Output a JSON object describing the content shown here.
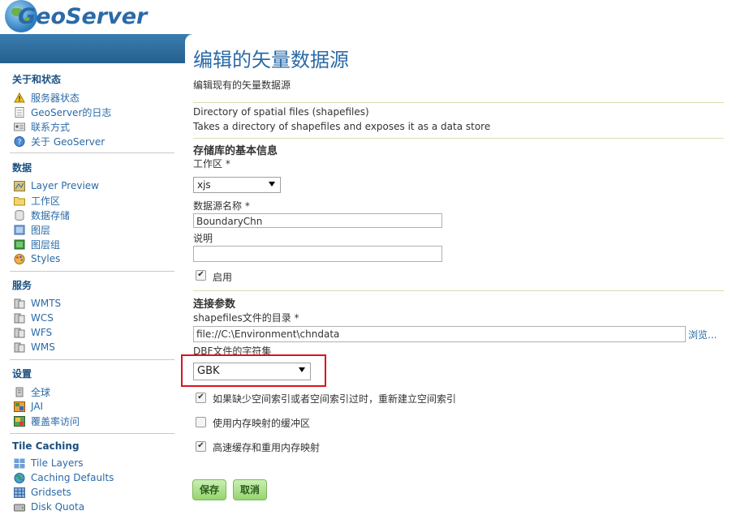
{
  "header": {
    "logo_text": "GeoServer"
  },
  "sidebar": {
    "sections": [
      {
        "title": "关于和状态",
        "items": [
          {
            "label": "服务器状态",
            "icon": "warning-icon"
          },
          {
            "label": "GeoServer的日志",
            "icon": "document-icon"
          },
          {
            "label": "联系方式",
            "icon": "contact-card-icon"
          },
          {
            "label": "关于 GeoServer",
            "icon": "help-icon"
          }
        ]
      },
      {
        "title": "数据",
        "items": [
          {
            "label": "Layer Preview",
            "icon": "map-preview-icon"
          },
          {
            "label": "工作区",
            "icon": "folder-icon"
          },
          {
            "label": "数据存储",
            "icon": "database-icon"
          },
          {
            "label": "图层",
            "icon": "layer-icon"
          },
          {
            "label": "图层组",
            "icon": "layer-group-icon"
          },
          {
            "label": "Styles",
            "icon": "palette-icon"
          }
        ]
      },
      {
        "title": "服务",
        "items": [
          {
            "label": "WMTS",
            "icon": "server-icon"
          },
          {
            "label": "WCS",
            "icon": "server-icon"
          },
          {
            "label": "WFS",
            "icon": "server-icon"
          },
          {
            "label": "WMS",
            "icon": "server-icon"
          }
        ]
      },
      {
        "title": "设置",
        "items": [
          {
            "label": "全球",
            "icon": "server-icon"
          },
          {
            "label": "JAI",
            "icon": "jai-icon"
          },
          {
            "label": "覆盖率访问",
            "icon": "coverage-icon"
          }
        ]
      },
      {
        "title": "Tile Caching",
        "items": [
          {
            "label": "Tile Layers",
            "icon": "tile-icon"
          },
          {
            "label": "Caching Defaults",
            "icon": "globe-icon"
          },
          {
            "label": "Gridsets",
            "icon": "grid-icon"
          },
          {
            "label": "Disk Quota",
            "icon": "disk-icon"
          }
        ]
      }
    ]
  },
  "main": {
    "title": "编辑的矢量数据源",
    "subtitle": "编辑现有的矢量数据源",
    "store_type": "Directory of spatial files (shapefiles)",
    "store_desc": "Takes a directory of shapefiles and exposes it as a data store",
    "basic_info_heading": "存储库的基本信息",
    "workspace_label": "工作区 *",
    "workspace_value": "xjs",
    "name_label": "数据源名称 *",
    "name_value": "BoundaryChn",
    "description_label": "说明",
    "description_value": "",
    "enabled_label": "启用",
    "enabled": true,
    "conn_heading": "连接参数",
    "dir_label": "shapefiles文件的目录 *",
    "dir_value": "file://C:\\Environment\\chndata",
    "browse_label": "浏览...",
    "charset_label": "DBF文件的字符集",
    "charset_value": "GBK",
    "opt1_label": "如果缺少空间索引或者空间索引过时，重新建立空间索引",
    "opt1": true,
    "opt2_label": "使用内存映射的缓冲区",
    "opt2": false,
    "opt3_label": "高速缓存和重用内存映射",
    "opt3": true,
    "save_label": "保存",
    "cancel_label": "取消"
  },
  "colors": {
    "accent": "#2a6aa8",
    "header_bar": "#2f6f9f",
    "highlight": "#d9141e",
    "button": "#95d46e"
  }
}
